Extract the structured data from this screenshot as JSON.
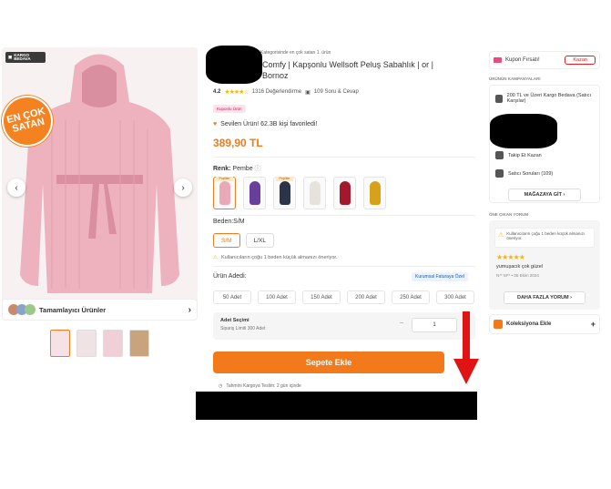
{
  "gallery": {
    "cargo_badge": "KARGO BEDAVA",
    "bestseller_line1": "EN ÇOK",
    "bestseller_line2": "SATAN",
    "complementary_label": "Tamamlayıcı Ürünler"
  },
  "product": {
    "breadcrumb": "Kategorisinde en çok satan 1. ürün",
    "title": "Comfy | Kapşonlu Wellsoft Peluş Sabahlık | or | Bornoz",
    "rating": "4.2",
    "review_count": "1316 Değerlendirme",
    "qa_count": "109 Soru & Cevap",
    "badge": "Kuponlu Ürün",
    "fav_text": "Sevilen Ürün! 62.3B kişi favoriledi!",
    "price": "389,90 TL",
    "color_label": "Renk:",
    "color_value": "Pembe",
    "swatch_tags": [
      "Popüler",
      "",
      "Popüler",
      "",
      "",
      ""
    ],
    "swatch_colors": [
      "#e9a9b8",
      "#6a3f9c",
      "#2b3448",
      "#e6e2dc",
      "#a5182b",
      "#d6a21a"
    ],
    "size_label": "Beden:S/M",
    "sizes": [
      "S/M",
      "L/XL"
    ],
    "size_warning": "Kullanıcıların çoğu 1 beden küçük almanızı öneriyor.",
    "quantity_label": "Ürün Adedi:",
    "corporate_badge": "Kurumsal Faturaya Özel",
    "quantities": [
      "50 Adet",
      "100 Adet",
      "150 Adet",
      "200 Adet",
      "250 Adet",
      "300 Adet"
    ],
    "adet_title": "Adet Seçimi",
    "adet_sub": "Sipariş Limiti 300 Adet",
    "adet_value": "1",
    "cart_button": "Sepete Ekle",
    "shipping_note": "Tahmini Kargoya Teslim: 2 gün içinde"
  },
  "sidebar": {
    "coupon_text": "Kupon Fırsatı!",
    "coupon_button": "Kazan",
    "campaigns_header": "ÜRÜNÜN KAMPANYALARI",
    "campaign1": "200 TL ve Üzeri Kargo Bedava (Satıcı Karşılar)",
    "follow": "Takip Et Kazan",
    "seller_questions": "Satıcı Soruları (109)",
    "store_button": "MAĞAZAYA GİT",
    "reviews_header": "ÖNE ÇIKAN YORUM",
    "review_note": "Kullanıcıların çoğu 1 beden küçük almanızı öneriyor.",
    "review_stars": "★★★★★",
    "review_text": "yumuşacık çok güzel",
    "review_meta": "N** M** • 05 Ekim 2024",
    "more_reviews": "DAHA FAZLA YORUM",
    "collection": "Koleksiyona Ekle"
  },
  "colors": {
    "accent": "#f27a1a",
    "robe_pink": "#e9a9b8"
  }
}
